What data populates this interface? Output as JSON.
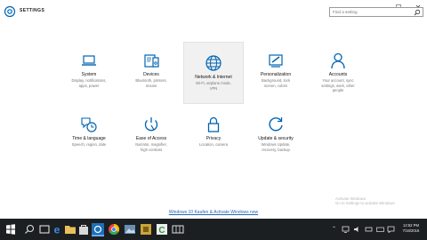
{
  "window": {
    "title": "SETTINGS",
    "minimize": "—",
    "maximize": "☐",
    "close": "✕"
  },
  "search": {
    "placeholder": "Find a setting"
  },
  "tiles": [
    {
      "name": "System",
      "desc": "Display, notifications,\napps, power",
      "icon": "laptop-icon"
    },
    {
      "name": "Devices",
      "desc": "Bluetooth, printers,\nmouse",
      "icon": "devices-icon"
    },
    {
      "name": "Network & Internet",
      "desc": "Wi-Fi, airplane mode,\nVPN",
      "icon": "globe-icon"
    },
    {
      "name": "Personalization",
      "desc": "Background, lock\nscreen, colors",
      "icon": "paintbrush-icon"
    },
    {
      "name": "Accounts",
      "desc": "Your account, sync\nsettings, work, other\npeople",
      "icon": "person-icon"
    },
    {
      "name": "Time & language",
      "desc": "Speech, region, date",
      "icon": "time-language-icon"
    },
    {
      "name": "Ease of Access",
      "desc": "Narrator, magnifier,\nhigh contrast",
      "icon": "ease-of-access-icon"
    },
    {
      "name": "Privacy",
      "desc": "Location, camera",
      "icon": "lock-icon"
    },
    {
      "name": "Update & security",
      "desc": "Windows Update,\nrecovery, backup",
      "icon": "refresh-icon"
    }
  ],
  "activation_link": "Windows 10 Kaufen & Activate Windows now",
  "watermark": {
    "line1": "Activate Windows",
    "line2": "Go to Settings to activate Windows."
  },
  "taskbar": {
    "clock_time": "12:52 PM",
    "clock_date": "7/16/2016"
  },
  "colors": {
    "icon_blue": "#0063b1",
    "taskbar": "#1c1f22",
    "link": "#2a64b8"
  }
}
